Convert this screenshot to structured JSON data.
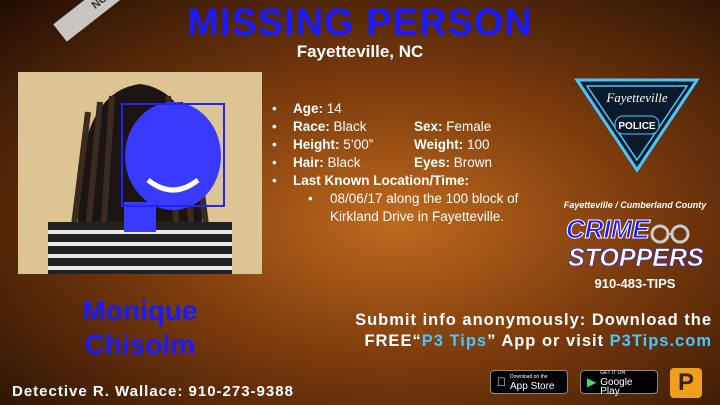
{
  "header": {
    "title": "MISSING PERSON",
    "city": "Fayetteville, NC",
    "tape_text": "NOT CROSS"
  },
  "person": {
    "name_first": "Monique",
    "name_last": "Chisolm",
    "age_label": "Age:",
    "age": "14",
    "race_label": "Race:",
    "race": "Black",
    "sex_label": "Sex:",
    "sex": "Female",
    "height_label": "Height:",
    "height": "5’00”",
    "weight_label": "Weight:",
    "weight": "100",
    "hair_label": "Hair:",
    "hair": "Black",
    "eyes_label": "Eyes:",
    "eyes": "Brown",
    "location_label": "Last Known Location/Time:",
    "location_line1": "08/06/17 along the 100 block of",
    "location_line2": "Kirkland Drive in Fayetteville."
  },
  "police_logo": {
    "city_text": "Fayetteville",
    "police_text": "POLICE"
  },
  "crimestoppers": {
    "heading": "Fayetteville / Cumberland County",
    "crime": "CRIME",
    "stoppers": "STOPPERS",
    "phone": "910-483-TIPS"
  },
  "submit": {
    "line1": "Submit info anonymously: Download the",
    "line2_pre": "FREE“",
    "line2_app": "P3 Tips",
    "line2_mid": "” App or visit ",
    "line2_site": "P3Tips.com"
  },
  "detective": "Detective R. Wallace: 910-273-9388",
  "stores": {
    "apple_small": "Download on the",
    "apple_big": "App Store",
    "google_small": "GET IT ON",
    "google_big": "Google Play"
  },
  "p3_badge": "P"
}
